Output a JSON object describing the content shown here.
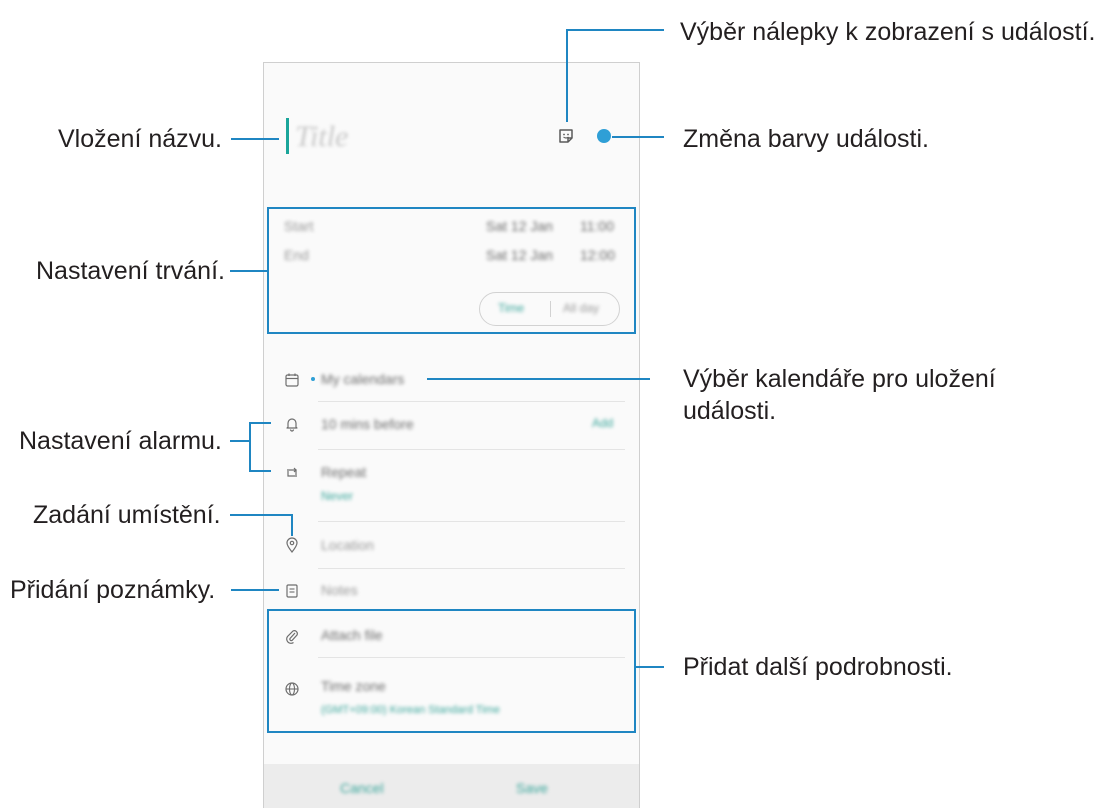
{
  "event_form": {
    "title_placeholder": "Title",
    "start_label": "Start",
    "start_date": "Sat 12 Jan",
    "start_time": "11:00",
    "end_label": "End",
    "end_date": "Sat 12 Jan",
    "end_time": "12:00",
    "time_option": "Time",
    "all_day_option": "All day",
    "calendar_value": "My calendars",
    "alarm_value": "10 mins before",
    "alarm_add": "Add",
    "repeat_label": "Repeat",
    "repeat_value": "Never",
    "location_placeholder": "Location",
    "notes_placeholder": "Notes",
    "attach_file_label": "Attach file",
    "time_zone_label": "Time zone",
    "time_zone_value": "(GMT+09:00) Korean Standard Time",
    "cancel_label": "Cancel",
    "save_label": "Save",
    "accent_color": "#1aa59a",
    "event_color": "#2f9fd6"
  },
  "callouts": {
    "sticker": "Výběr nálepky k zobrazení s událostí.",
    "title": "Vložení názvu.",
    "color": "Změna barvy události.",
    "duration": "Nastavení trvání.",
    "calendar_line1": "Výběr kalendáře pro uložení",
    "calendar_line2": "události.",
    "alarm": "Nastavení alarmu.",
    "location": "Zadání umístění.",
    "notes": "Přidání poznámky.",
    "more": "Přidat další podrobnosti."
  },
  "annotation_color": "#1f86c2"
}
